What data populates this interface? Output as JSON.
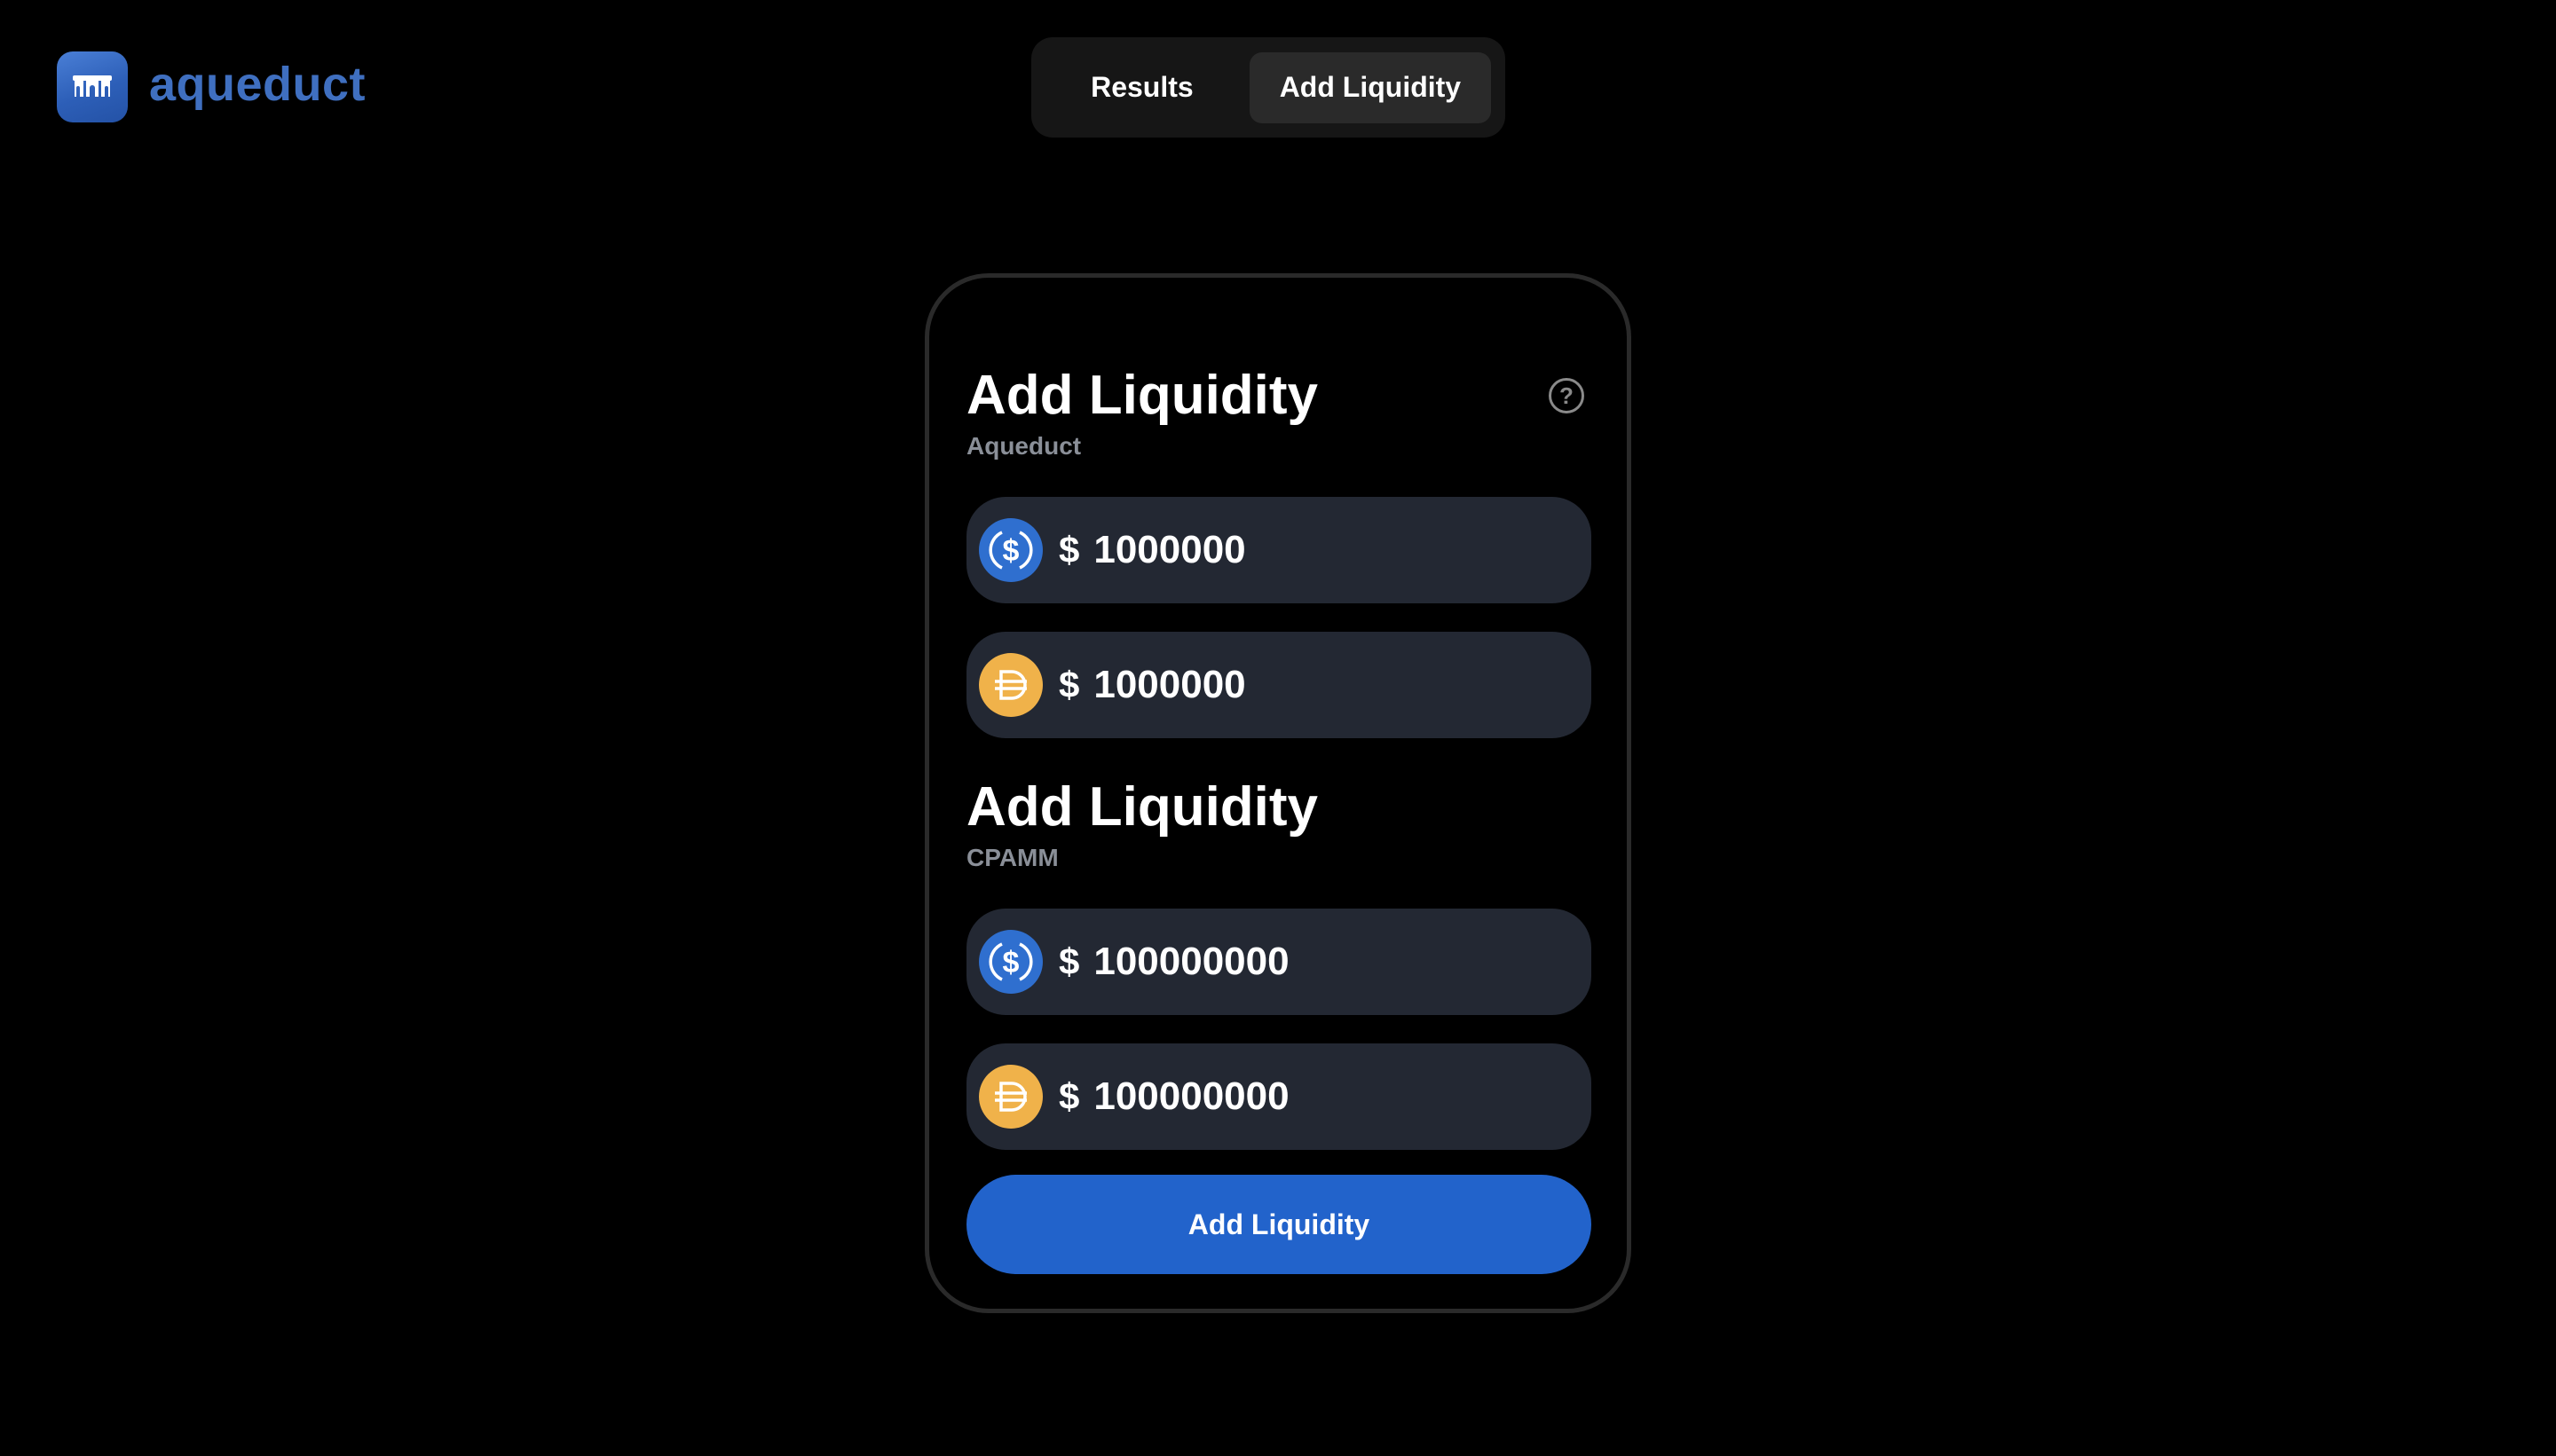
{
  "brand": {
    "name": "aqueduct",
    "icon": "aqueduct-logo-icon",
    "accent": "#3f6fc0"
  },
  "nav": {
    "tabs": [
      {
        "label": "Results",
        "active": false
      },
      {
        "label": "Add Liquidity",
        "active": true
      }
    ]
  },
  "card": {
    "help_icon": "question-circle-icon",
    "sections": [
      {
        "title": "Add Liquidity",
        "subtitle": "Aqueduct",
        "inputs": [
          {
            "token_icon": "usdc-icon",
            "currency_symbol": "$",
            "value": "1000000"
          },
          {
            "token_icon": "dai-icon",
            "currency_symbol": "$",
            "value": "1000000"
          }
        ]
      },
      {
        "title": "Add Liquidity",
        "subtitle": "CPAMM",
        "inputs": [
          {
            "token_icon": "usdc-icon",
            "currency_symbol": "$",
            "value": "100000000"
          },
          {
            "token_icon": "dai-icon",
            "currency_symbol": "$",
            "value": "100000000"
          }
        ]
      }
    ],
    "submit_label": "Add Liquidity"
  },
  "colors": {
    "background": "#000000",
    "input_background": "#232833",
    "button": "#2263cb",
    "usdc": "#2f6fcf",
    "dai": "#f0b24a",
    "subtitle": "#8a8f98"
  }
}
